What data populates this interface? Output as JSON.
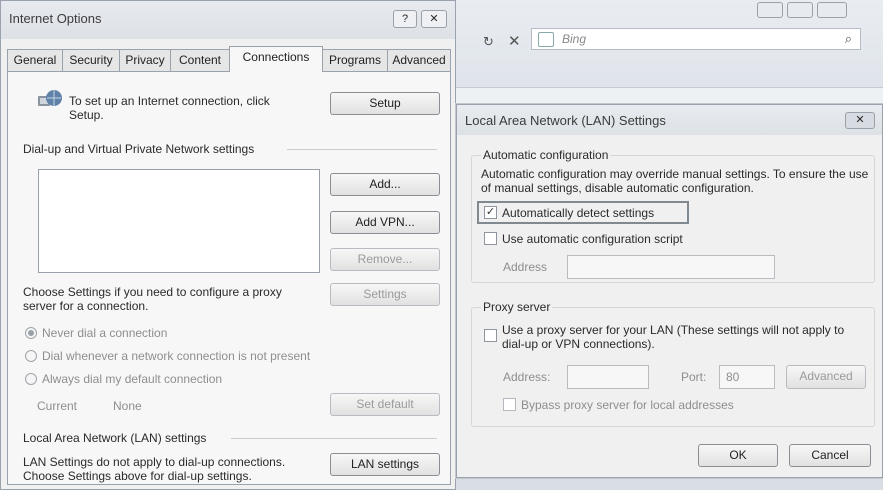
{
  "browser": {
    "search_placeholder": "Bing"
  },
  "internet_options": {
    "title": "Internet Options",
    "tabs": [
      {
        "label": "General"
      },
      {
        "label": "Security"
      },
      {
        "label": "Privacy"
      },
      {
        "label": "Content"
      },
      {
        "label": "Connections"
      },
      {
        "label": "Programs"
      },
      {
        "label": "Advanced"
      }
    ],
    "active_tab": "Connections",
    "setup_text": "To set up an Internet connection, click Setup.",
    "setup_button": "Setup",
    "dialup_heading": "Dial-up and Virtual Private Network settings",
    "add_button": "Add...",
    "add_vpn_button": "Add VPN...",
    "remove_button": "Remove...",
    "proxy_text": "Choose Settings if you need to configure a proxy server for a connection.",
    "settings_button": "Settings",
    "radios": [
      {
        "label": "Never dial a connection",
        "selected": true
      },
      {
        "label": "Dial whenever a network connection is not present",
        "selected": false
      },
      {
        "label": "Always dial my default connection",
        "selected": false
      }
    ],
    "current_label": "Current",
    "current_value": "None",
    "set_default_button": "Set default",
    "lan_heading": "Local Area Network (LAN) settings",
    "lan_text": "LAN Settings do not apply to dial-up connections. Choose Settings above for dial-up settings.",
    "lan_settings_button": "LAN settings"
  },
  "lan_dialog": {
    "title": "Local Area Network (LAN) Settings",
    "auto_config_heading": "Automatic configuration",
    "auto_config_text": "Automatic configuration may override manual settings.  To ensure the use of manual settings, disable automatic configuration.",
    "auto_detect_label": "Automatically detect settings",
    "auto_detect_checked": true,
    "auto_script_label": "Use automatic configuration script",
    "auto_script_checked": false,
    "address_label": "Address",
    "address_value": "",
    "proxy_heading": "Proxy server",
    "use_proxy_label": "Use a proxy server for your LAN (These settings will not apply to dial-up or VPN connections).",
    "use_proxy_checked": false,
    "proxy_address_label": "Address:",
    "port_label": "Port:",
    "port_value": "80",
    "advanced_button": "Advanced",
    "bypass_label": "Bypass proxy server for local addresses",
    "bypass_checked": false,
    "ok_button": "OK",
    "cancel_button": "Cancel"
  }
}
